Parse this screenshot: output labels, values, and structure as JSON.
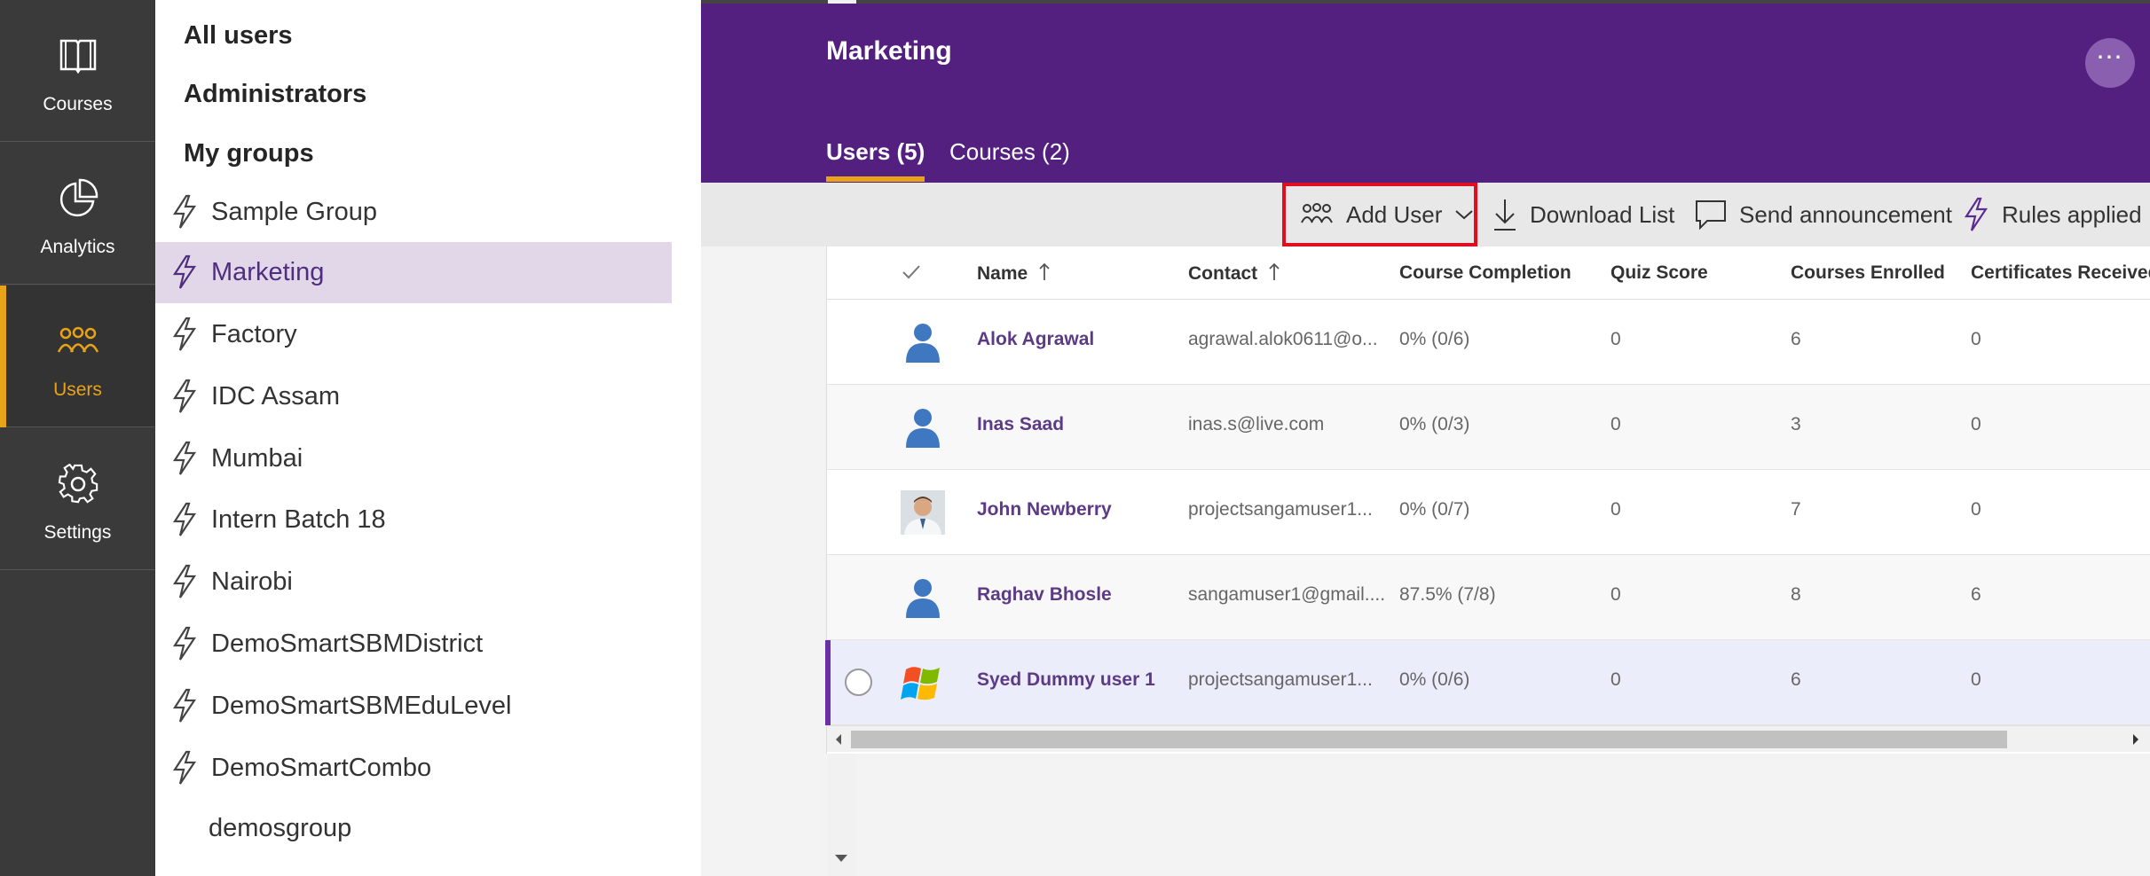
{
  "nav": {
    "items": [
      {
        "label": "Courses",
        "icon": "book-icon"
      },
      {
        "label": "Analytics",
        "icon": "pie-chart-icon"
      },
      {
        "label": "Users",
        "icon": "users-icon",
        "active": true
      },
      {
        "label": "Settings",
        "icon": "gear-icon"
      }
    ]
  },
  "groups": {
    "all_users": "All users",
    "administrators": "Administrators",
    "my_groups": "My groups",
    "items": [
      {
        "label": "Sample Group"
      },
      {
        "label": "Marketing",
        "selected": true
      },
      {
        "label": "Factory"
      },
      {
        "label": "IDC Assam"
      },
      {
        "label": "Mumbai"
      },
      {
        "label": "Intern Batch 18"
      },
      {
        "label": "Nairobi"
      },
      {
        "label": "DemoSmartSBMDistrict"
      },
      {
        "label": "DemoSmartSBMEduLevel"
      },
      {
        "label": "DemoSmartCombo"
      }
    ],
    "plain_item": "demosgroup"
  },
  "header": {
    "title": "Marketing",
    "more": "⋯",
    "tabs": [
      {
        "label": "Users (5)",
        "active": true
      },
      {
        "label": "Courses (2)"
      }
    ]
  },
  "toolbar": {
    "add_user": "Add User",
    "download_list": "Download List",
    "send_announcement": "Send announcement",
    "rules_applied": "Rules applied"
  },
  "table": {
    "columns": {
      "name": "Name",
      "contact": "Contact",
      "completion": "Course Completion",
      "quiz": "Quiz Score",
      "enrolled": "Courses Enrolled",
      "certificates": "Certificates Received"
    },
    "rows": [
      {
        "name": "Alok Agrawal",
        "contact": "agrawal.alok0611@o...",
        "completion": "0% (0/6)",
        "quiz": "0",
        "enrolled": "6",
        "certificates": "0",
        "avatar": "person-icon"
      },
      {
        "name": "Inas Saad",
        "contact": "inas.s@live.com",
        "completion": "0% (0/3)",
        "quiz": "0",
        "enrolled": "3",
        "certificates": "0",
        "avatar": "person-icon"
      },
      {
        "name": "John Newberry",
        "contact": "projectsangamuser1...",
        "completion": "0% (0/7)",
        "quiz": "0",
        "enrolled": "7",
        "certificates": "0",
        "avatar": "photo-avatar"
      },
      {
        "name": "Raghav Bhosle",
        "contact": "sangamuser1@gmail....",
        "completion": "87.5% (7/8)",
        "quiz": "0",
        "enrolled": "8",
        "certificates": "6",
        "avatar": "person-icon"
      },
      {
        "name": "Syed Dummy user 1",
        "contact": "projectsangamuser1...",
        "completion": "0% (0/6)",
        "quiz": "0",
        "enrolled": "6",
        "certificates": "0",
        "avatar": "windows-logo-icon",
        "selected": true
      }
    ]
  },
  "colors": {
    "header": "#532080",
    "accent": "#e8a317",
    "rail": "#3a3a3a",
    "selected_group": "#e2d7e8",
    "link": "#5c3a86",
    "highlight_box": "#e00e1e"
  }
}
